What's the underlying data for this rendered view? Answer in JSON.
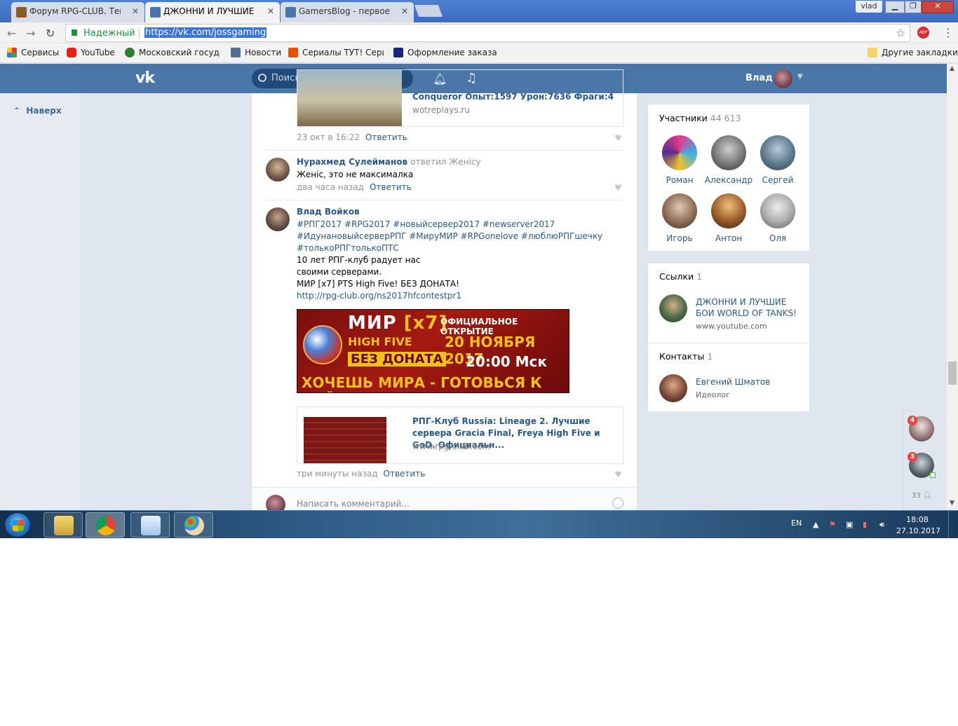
{
  "browser": {
    "tabs": [
      {
        "title": "Форум RPG-CLUB. Тема",
        "active": false
      },
      {
        "title": "ДЖОННИ И ЛУЧШИЕ БО",
        "active": true
      },
      {
        "title": "GamersBlog - первое го",
        "active": false
      }
    ],
    "profile_name": "vlad",
    "secure_label": "Надежный",
    "url": "https://vk.com/jossgaming",
    "abp_count": "1",
    "bookmarks": [
      "Сервисы",
      "YouTube",
      "Московский государ",
      "Новости",
      "Сериалы ТУТ! Сериа",
      "Оформление заказа"
    ],
    "other_bookmarks": "Другие закладки"
  },
  "vk_header": {
    "logo": "vk",
    "search_placeholder": "Поиск",
    "user_name": "Влад"
  },
  "left_nav": {
    "back_to_top": "Наверх"
  },
  "wall": {
    "first_card": {
      "title": "Conqueror Опыт:1597 Урон:7636 Фраги:4",
      "domain": "wotreplays.ru"
    },
    "first_meta": {
      "time": "23 окт в 16:22",
      "reply": "Ответить"
    },
    "comments": [
      {
        "author": "Нурахмед Сулейманов",
        "reply_to": "ответил Женісу",
        "text": "Женіс, это не максималка",
        "time": "два часа назад",
        "reply": "Ответить"
      },
      {
        "author": "Влад Войков",
        "tags": "#РПГ2017 #RPG2017 #новыйсервер2017 #newserver2017 #ИдунановыйсерверРПГ #МируМИР #RPGonelove #люблюРПГшечку #толькоРПГтолькоПТС",
        "text_lines": [
          "10 лет РПГ-клуб радует нас",
          "своими серверами.",
          "МИР [x7] PTS High Five! БЕЗ ДОНАТА!"
        ],
        "link": "http://rpg-club.org/ns2017hfcontestpr1",
        "banner": {
          "l1": "МИР",
          "l1b": "[x7]",
          "l2": "HIGH FIVE",
          "l3": "БЕЗ ДОНАТА",
          "l4": "ОФИЦИАЛЬНОЕ ОТКРЫТИЕ",
          "l5": "20 НОЯБРЯ 2017",
          "l6": "20:00 Мск",
          "l7": "ХОЧЕШЬ МИРА - ГОТОВЬСЯ К ВОЙНЕ"
        },
        "card": {
          "title": "РПГ-Клуб Russia: Lineage 2. Лучшие сервера Gracia Final, Freya High Five и GoD. Официальн...",
          "domain": "www.rpg-club.com"
        },
        "time": "три минуты назад",
        "reply": "Ответить"
      }
    ],
    "write_placeholder": "Написать комментарий..."
  },
  "members": {
    "title": "Участники",
    "count": "44 613",
    "people": [
      "Роман",
      "Александр",
      "Сергей",
      "Игорь",
      "Антон",
      "Оля"
    ]
  },
  "links": {
    "title": "Ссылки",
    "count": "1",
    "item_title": "ДЖОННИ И ЛУЧШИЕ БОИ WORLD OF TANKS!",
    "item_url": "www.youtube.com"
  },
  "contacts": {
    "title": "Контакты",
    "count": "1",
    "name": "Евгений Шматов",
    "role": "Идеолог"
  },
  "chat": {
    "badges": [
      "4",
      "3"
    ],
    "online_count": "33"
  },
  "taskbar": {
    "lang": "EN",
    "time": "18:08",
    "date": "27.10.2017"
  },
  "colors": {
    "vk_blue": "#4a76a8",
    "link": "#2a5885",
    "secure_green": "#1e8e3e"
  }
}
